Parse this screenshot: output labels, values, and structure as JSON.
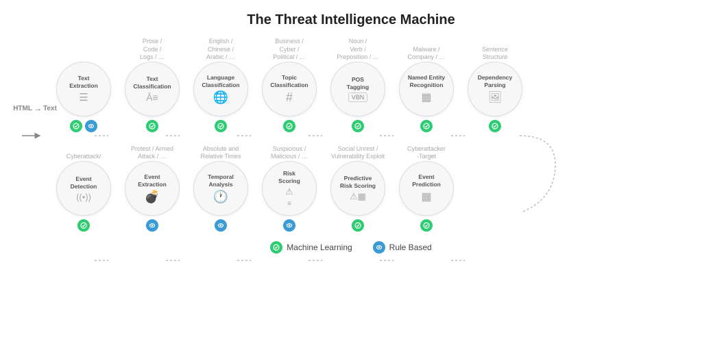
{
  "title": "The Threat Intelligence Machine",
  "row1": {
    "html_label": "HTML",
    "arrow": "→",
    "text_label": "Text",
    "nodes": [
      {
        "id": "text-extraction",
        "label": "Text\nExtraction",
        "sublabel": "",
        "icon": "☰",
        "badges": [
          "green",
          "blue"
        ]
      },
      {
        "id": "text-classification",
        "label": "Text\nClassification",
        "sublabel": "Prose /\nCode /\nLogs / …",
        "icon": "Ā≡",
        "badges": [
          "green"
        ]
      },
      {
        "id": "language-classification",
        "label": "Language\nClassification",
        "sublabel": "English /\nChinese /\nArabic / …",
        "icon": "🌐",
        "badges": [
          "green"
        ]
      },
      {
        "id": "topic-classification",
        "label": "Topic\nClassification",
        "sublabel": "Business /\nCyber /\nPolitical / …",
        "icon": "#",
        "badges": [
          "green"
        ]
      },
      {
        "id": "pos-tagging",
        "label": "POS\nTagging",
        "sublabel": "Noun /\nVerb /\nPreposition / …",
        "icon": "VBN",
        "badges": [
          "green"
        ]
      },
      {
        "id": "named-entity",
        "label": "Named Entity\nRecognition",
        "sublabel": "Malware /\nCompany / …",
        "icon": "▦",
        "badges": [
          "green"
        ]
      },
      {
        "id": "dependency-parsing",
        "label": "Dependency\nParsing",
        "sublabel": "Sentence\nStructure",
        "icon": "🖼",
        "badges": [
          "green"
        ]
      }
    ]
  },
  "row2": {
    "nodes": [
      {
        "id": "event-detection",
        "label": "Event\nDetection",
        "sublabel": "Cyberattack/",
        "icon": "((•))",
        "badges": [
          "green"
        ]
      },
      {
        "id": "event-extraction",
        "label": "Event\nExtraction",
        "sublabel": "Protest / Armed\nAttack / …",
        "icon": "💣",
        "badges": [
          "blue"
        ]
      },
      {
        "id": "temporal-analysis",
        "label": "Temporal\nAnalysis",
        "sublabel": "Absolute and\nRelative Times",
        "icon": "🕐",
        "badges": [
          "blue"
        ]
      },
      {
        "id": "risk-scoring",
        "label": "Risk\nScoring",
        "sublabel": "Suspicious /\nMalicious / …",
        "icon": "⚠≡",
        "badges": [
          "blue"
        ]
      },
      {
        "id": "predictive-risk",
        "label": "Predictive\nRisk Scoring",
        "sublabel": "Social Unrest /\nVulnerability Exploit",
        "icon": "⚠▦",
        "badges": [
          "green"
        ]
      },
      {
        "id": "event-prediction",
        "label": "Event\nPrediction",
        "sublabel": "Cyberattacker\n-Target",
        "icon": "▦",
        "badges": [
          "green"
        ]
      }
    ]
  },
  "legend": [
    {
      "id": "ml",
      "color": "green",
      "label": "Machine Learning"
    },
    {
      "id": "rb",
      "color": "blue",
      "label": "Rule Based"
    }
  ],
  "colors": {
    "green": "#2ecc71",
    "blue": "#3a9bd5",
    "dashed": "#bbb",
    "circle_bg": "#f7f8f9",
    "circle_border": "#ddd"
  }
}
